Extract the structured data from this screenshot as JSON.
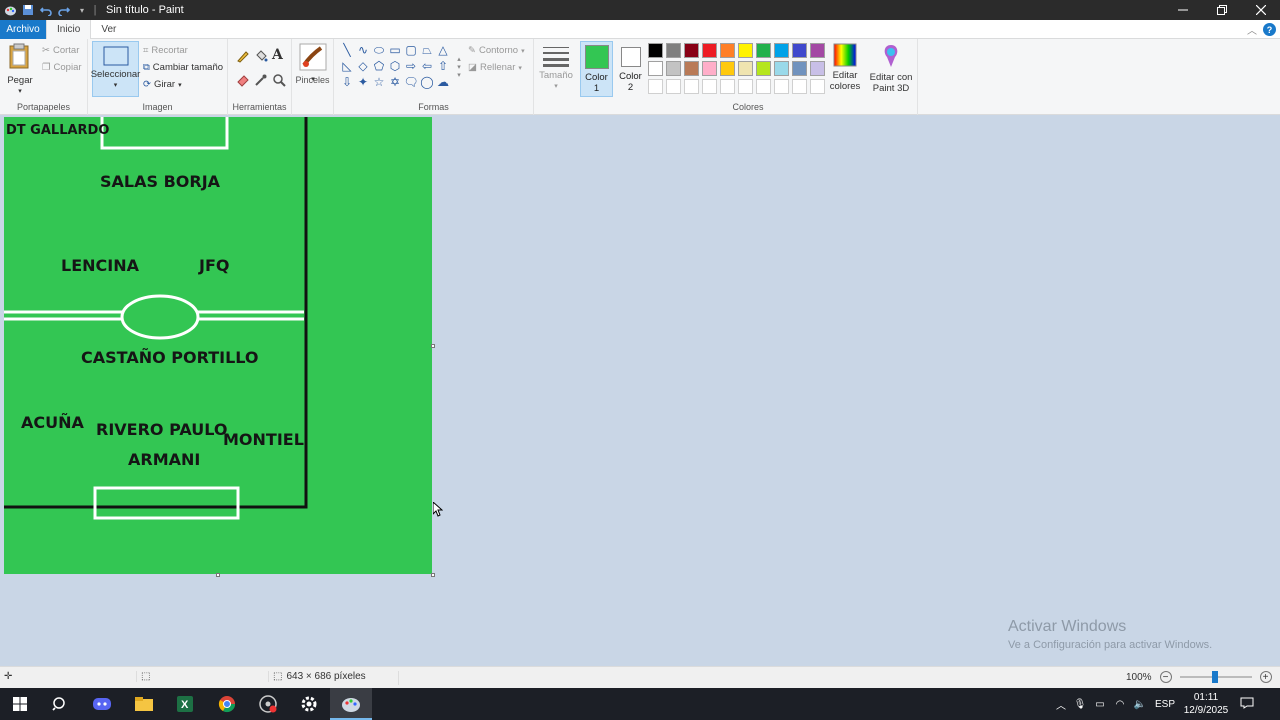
{
  "window": {
    "title": "Sin título - Paint",
    "controls": [
      "minimize-icon",
      "restore-icon",
      "close-icon"
    ]
  },
  "tabs": {
    "file": "Archivo",
    "home": "Inicio",
    "view": "Ver"
  },
  "ribbon": {
    "clipboard": {
      "label": "Portapapeles",
      "paste": "Pegar",
      "cut": "Cortar",
      "copy": "Copiar"
    },
    "image": {
      "label": "Imagen",
      "select": "Seleccionar",
      "crop": "Recortar",
      "resize": "Cambiar tamaño",
      "rotate": "Girar"
    },
    "tools": {
      "label": "Herramientas"
    },
    "brushes": {
      "label": "Pinceles"
    },
    "shapes": {
      "label": "Formas",
      "outline": "Contorno",
      "fill": "Rellenar"
    },
    "size": {
      "label": "Tamaño"
    },
    "color1": {
      "label": "Color 1",
      "value": "#33c653"
    },
    "color2": {
      "label": "Color 2",
      "value": "#ffffff"
    },
    "colors": {
      "label": "Colores",
      "row1": [
        "#000000",
        "#7f7f7f",
        "#880015",
        "#ed1c24",
        "#ff7f27",
        "#fff200",
        "#22b14c",
        "#00a2e8",
        "#3f48cc",
        "#a349a4"
      ],
      "row2": [
        "#ffffff",
        "#c3c3c3",
        "#b97a57",
        "#ffaec9",
        "#ffc90e",
        "#efe4b0",
        "#b5e61d",
        "#99d9ea",
        "#7092be",
        "#c8bfe7"
      ],
      "row3": [
        "#ffffff",
        "#ffffff",
        "#ffffff",
        "#ffffff",
        "#ffffff",
        "#ffffff",
        "#ffffff",
        "#ffffff",
        "#ffffff",
        "#ffffff"
      ]
    },
    "edit_colors": "Editar colores",
    "paint3d": "Editar con Paint 3D"
  },
  "canvas": {
    "background": "#33c653",
    "labels": {
      "coach": "DT GALLARDO",
      "fwd": "SALAS BORJA",
      "mid_left": "LENCINA",
      "mid_right": "JFQ",
      "cmid": "CASTAÑO PORTILLO",
      "lb": "ACUÑA",
      "cb": "RIVERO PAULO",
      "rb": "MONTIEL",
      "gk": "ARMANI"
    }
  },
  "watermark": {
    "line1": "Activar Windows",
    "line2": "Ve a Configuración para activar Windows."
  },
  "status": {
    "dimensions": "643 × 686 píxeles",
    "zoom": "100%"
  },
  "taskbar": {
    "lang": "ESP",
    "time": "01:11",
    "date": "12/9/2025"
  }
}
